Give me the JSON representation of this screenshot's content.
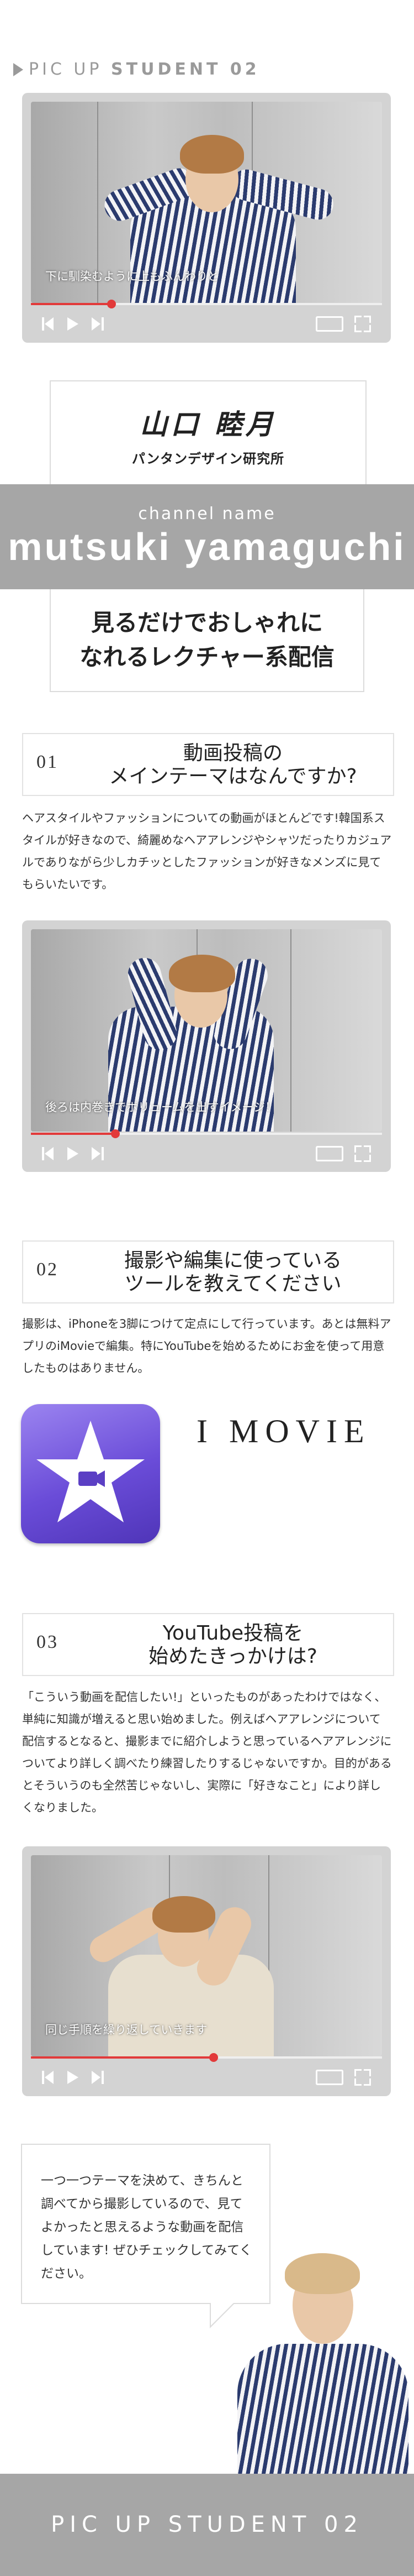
{
  "header": {
    "prefix": "PIC UP ",
    "bold": "STUDENT 02"
  },
  "videos": [
    {
      "caption": "下に馴染むように上もふんわりと",
      "progress": 0.23
    },
    {
      "caption": "後ろは内巻きでボリュームを出すイメージ！",
      "progress": 0.24
    },
    {
      "caption": "同じ手順を繰り返していきます",
      "progress": 0.52
    }
  ],
  "profile": {
    "name": "山口 睦月",
    "affiliation": "パンタンデザイン研究所",
    "channel_label": "channel name",
    "channel_name": "mutsuki yamaguchi",
    "catch_line1": "見るだけでおしゃれに",
    "catch_line2": "なれるレクチャー系配信"
  },
  "questions": [
    {
      "number": "01",
      "line1": "動画投稿の",
      "line2": "メインテーマはなんですか?",
      "answer": "ヘアスタイルやファッションについての動画がほとんどです!韓国系スタイルが好きなので、綺麗めなヘアアレンジやシャツだったりカジュアルでありながら少しカチッとしたファッションが好きなメンズに見てもらいたいです。"
    },
    {
      "number": "02",
      "line1": "撮影や編集に使っている",
      "line2": "ツールを教えてください",
      "answer": "撮影は、iPhoneを3脚につけて定点にして行っています。あとは無料アプリのiMovieで編集。特にYouTubeを始めるためにお金を使って用意したものはありません。"
    },
    {
      "number": "03",
      "line1": "YouTube投稿を",
      "line2": "始めたきっかけは?",
      "answer": "「こういう動画を配信したい!」といったものがあったわけではなく、単純に知識が増えると思い始めました。例えばヘアアレンジについて配信するとなると、撮影までに紹介しようと思っているヘアアレンジについてより詳しく調べたり練習したりするじゃないですか。目的があるとそういうのも全然苦じゃないし、実際に「好きなこと」により詳しくなりました。"
    }
  ],
  "tool": {
    "label": "I MOVIE",
    "icon": "imovie-icon"
  },
  "bubble": {
    "text": "一つ一つテーマを決めて、きちんと調べてから撮影しているので、見てよかったと思えるような動画を配信しています! ぜひチェックしてみてください。"
  },
  "footer": {
    "text": "PIC UP STUDENT 02"
  },
  "colors": {
    "band": "#a6a6a6",
    "progress": "#e23a3a",
    "imovie": "#6a4cd8"
  }
}
